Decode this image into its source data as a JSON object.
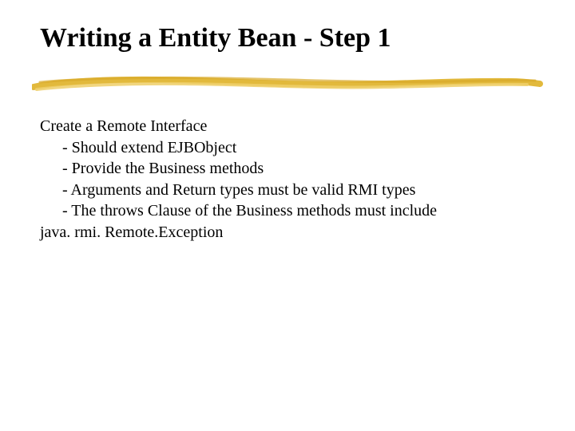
{
  "title": "Writing a Entity Bean - Step 1",
  "content": {
    "lead": "Create a Remote Interface",
    "bullets": [
      "- Should extend EJBObject",
      "- Provide the Business methods",
      "- Arguments and Return types must be valid RMI types",
      "- The throws Clause of the Business methods must include"
    ],
    "tail": "java. rmi. Remote.Exception"
  },
  "accent_color": "#e2b93c"
}
